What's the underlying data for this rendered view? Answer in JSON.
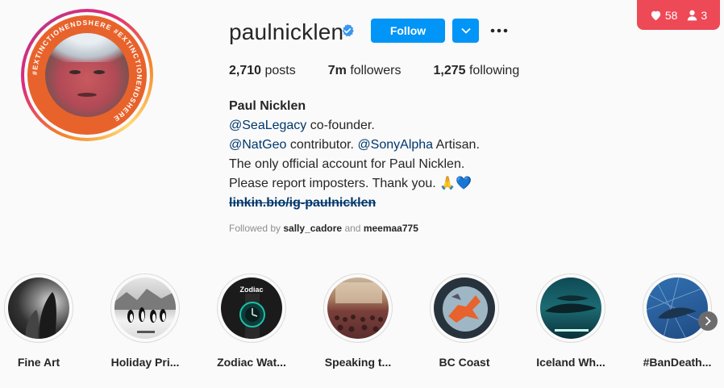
{
  "notifications": {
    "likes": "58",
    "follows": "3",
    "color": "#ed4956"
  },
  "profile": {
    "avatar_ring_text": "#EXTINCTIONENDSHERE",
    "username": "paulnicklen",
    "verified": true,
    "follow_label": "Follow",
    "accent": "#0095f6"
  },
  "stats": {
    "posts_count": "2,710",
    "posts_label": "posts",
    "followers_count": "7m",
    "followers_label": "followers",
    "following_count": "1,275",
    "following_label": "following"
  },
  "bio": {
    "full_name": "Paul Nicklen",
    "mention1": "@SeaLegacy",
    "line1_rest": " co-founder.",
    "mention2": "@NatGeo",
    "line2_mid": " contributor. ",
    "mention3": "@SonyAlpha",
    "line2_rest": " Artisan.",
    "line3": "The only official account for Paul Nicklen.",
    "line4": "Please report imposters. Thank you. 🙏💙",
    "link": "linkin.bio/ig-paulnicklen"
  },
  "followed_by": {
    "prefix": "Followed by",
    "user1": "sally_cadore",
    "conj": "and",
    "user2": "meemaa775"
  },
  "highlights": [
    {
      "label": "Fine Art",
      "icon": "fine-art-thumbnail"
    },
    {
      "label": "Holiday Pri...",
      "icon": "penguins-thumbnail"
    },
    {
      "label": "Zodiac Wat...",
      "icon": "watch-thumbnail",
      "overlay": "Zodiac"
    },
    {
      "label": "Speaking t...",
      "icon": "audience-thumbnail"
    },
    {
      "label": "BC Coast",
      "icon": "bc-coast-thumbnail"
    },
    {
      "label": "Iceland Wh...",
      "icon": "whales-thumbnail"
    },
    {
      "label": "#BanDeath...",
      "icon": "dolphins-thumbnail"
    }
  ]
}
